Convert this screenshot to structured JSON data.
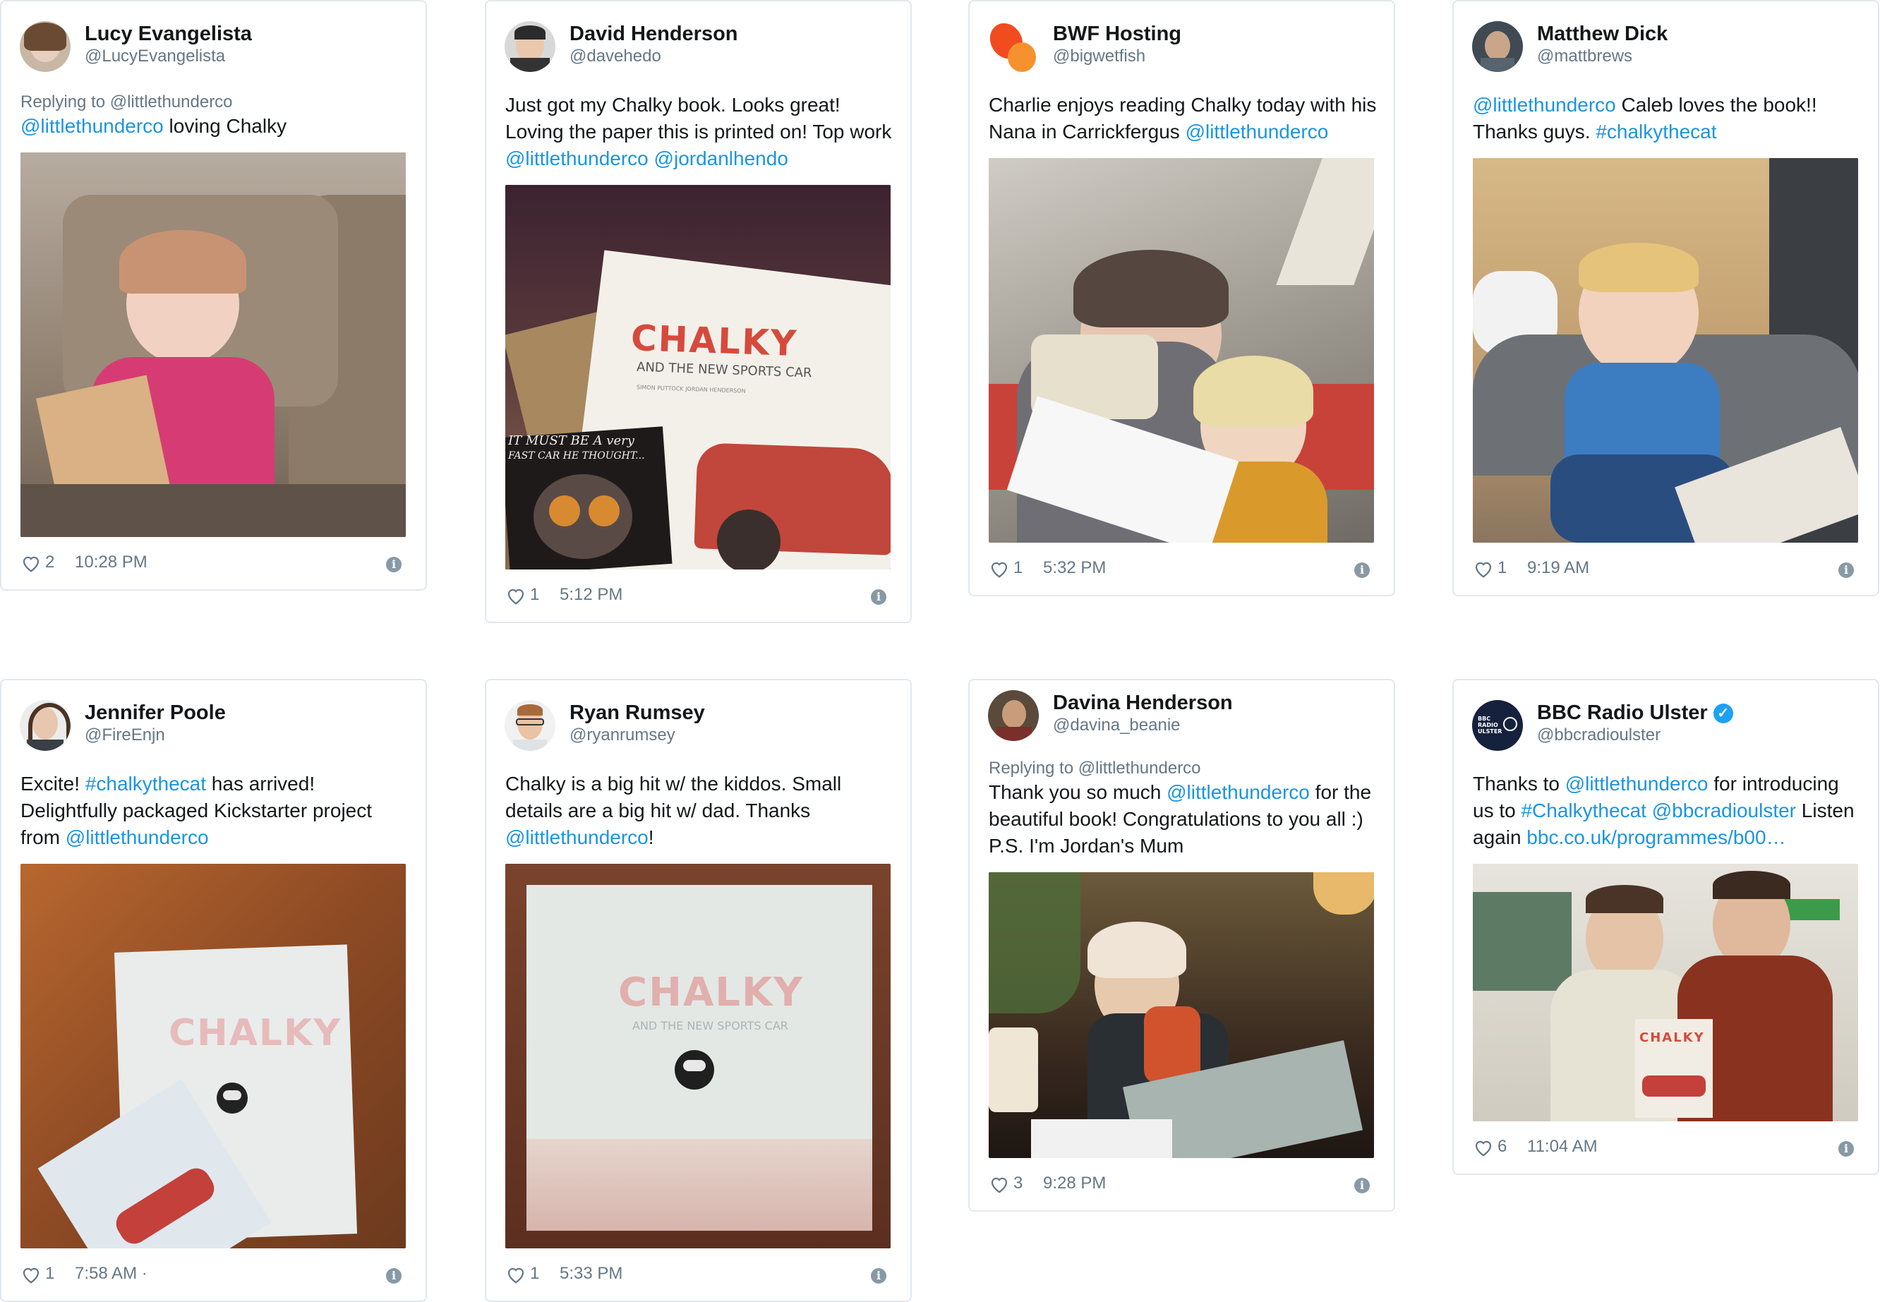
{
  "tweets": [
    {
      "name": "Lucy Evangelista",
      "handle": "@LucyEvangelista",
      "reply": "Replying to @littlethunderco",
      "parts": [
        [
          "@littlethunderco",
          "lk"
        ],
        [
          " loving Chalky",
          ""
        ]
      ],
      "likes": "2",
      "time": "10:28 PM"
    },
    {
      "name": "David Henderson",
      "handle": "@davehedo",
      "parts": [
        [
          "Just got my Chalky book. Looks great! Loving the paper this is printed on! Top work ",
          ""
        ],
        [
          "@littlethunderco",
          "lk"
        ],
        [
          " ",
          ""
        ],
        [
          "@jordanlhendo",
          "lk"
        ]
      ],
      "photo_text": {
        "title": "CHALKY",
        "subtitle": "AND THE NEW SPORTS CAR",
        "credits": "SIMON PUTTOCK   JORDAN HENDERSON",
        "page_line1": "IT MUST BE A very",
        "page_line2": "FAST CAR HE THOUGHT..."
      },
      "likes": "1",
      "time": "5:12 PM"
    },
    {
      "name": "BWF Hosting",
      "handle": "@bigwetfish",
      "parts": [
        [
          "Charlie enjoys reading Chalky today with his Nana in Carrickfergus ",
          ""
        ],
        [
          "@littlethunderco",
          "lk"
        ]
      ],
      "likes": "1",
      "time": "5:32 PM"
    },
    {
      "name": "Matthew Dick",
      "handle": "@mattbrews",
      "parts": [
        [
          "@littlethunderco",
          "lk"
        ],
        [
          " Caleb loves the book!! Thanks guys. ",
          ""
        ],
        [
          "#chalkythecat",
          "lk"
        ]
      ],
      "likes": "1",
      "time": "9:19 AM"
    },
    {
      "name": "Jennifer Poole",
      "handle": "@FireEnjn",
      "parts": [
        [
          "Excite! ",
          ""
        ],
        [
          "#chalkythecat",
          "lk"
        ],
        [
          " has arrived! Delightfully packaged Kickstarter project from ",
          ""
        ],
        [
          "@littlethunderco",
          "lk"
        ]
      ],
      "photo_text": {
        "title": "CHALKY"
      },
      "likes": "1",
      "time": "7:58 AM ·"
    },
    {
      "name": "Ryan Rumsey",
      "handle": "@ryanrumsey",
      "parts": [
        [
          "Chalky is a big hit w/ the kiddos. Small details are a big hit w/ dad. Thanks ",
          ""
        ],
        [
          "@littlethunderco",
          "lk"
        ],
        [
          "!",
          ""
        ]
      ],
      "photo_text": {
        "title": "CHALKY",
        "subtitle": "AND THE NEW SPORTS CAR"
      },
      "likes": "1",
      "time": "5:33 PM"
    },
    {
      "name": "Davina Henderson",
      "handle": "@davina_beanie",
      "reply": "Replying to @littlethunderco",
      "parts": [
        [
          "Thank you so much ",
          ""
        ],
        [
          "@littlethunderco",
          "lk"
        ],
        [
          " for the beautiful book! Congratulations to you all :) P.S. I'm Jordan's Mum",
          ""
        ]
      ],
      "likes": "3",
      "time": "9:28 PM"
    },
    {
      "name": "BBC Radio Ulster",
      "handle": "@bbcradioulster",
      "verified": true,
      "parts": [
        [
          "Thanks to ",
          ""
        ],
        [
          "@littlethunderco",
          "lk"
        ],
        [
          " for introducing us to ",
          ""
        ],
        [
          "#Chalkythecat",
          "lk"
        ],
        [
          " ",
          ""
        ],
        [
          "@bbcradioulster",
          "lk"
        ],
        [
          " Listen again ",
          ""
        ],
        [
          "bbc.co.uk/programmes/b00…",
          "lk"
        ]
      ],
      "photo_text": {
        "title": "CHALKY",
        "avatar_text": "BBC RADIO ULSTER"
      },
      "likes": "6",
      "time": "11:04 AM"
    }
  ],
  "colors": {
    "link": "#1b95e0",
    "meta": "#657786",
    "border": "#e1e8ed",
    "verified": "#1da1f2"
  }
}
